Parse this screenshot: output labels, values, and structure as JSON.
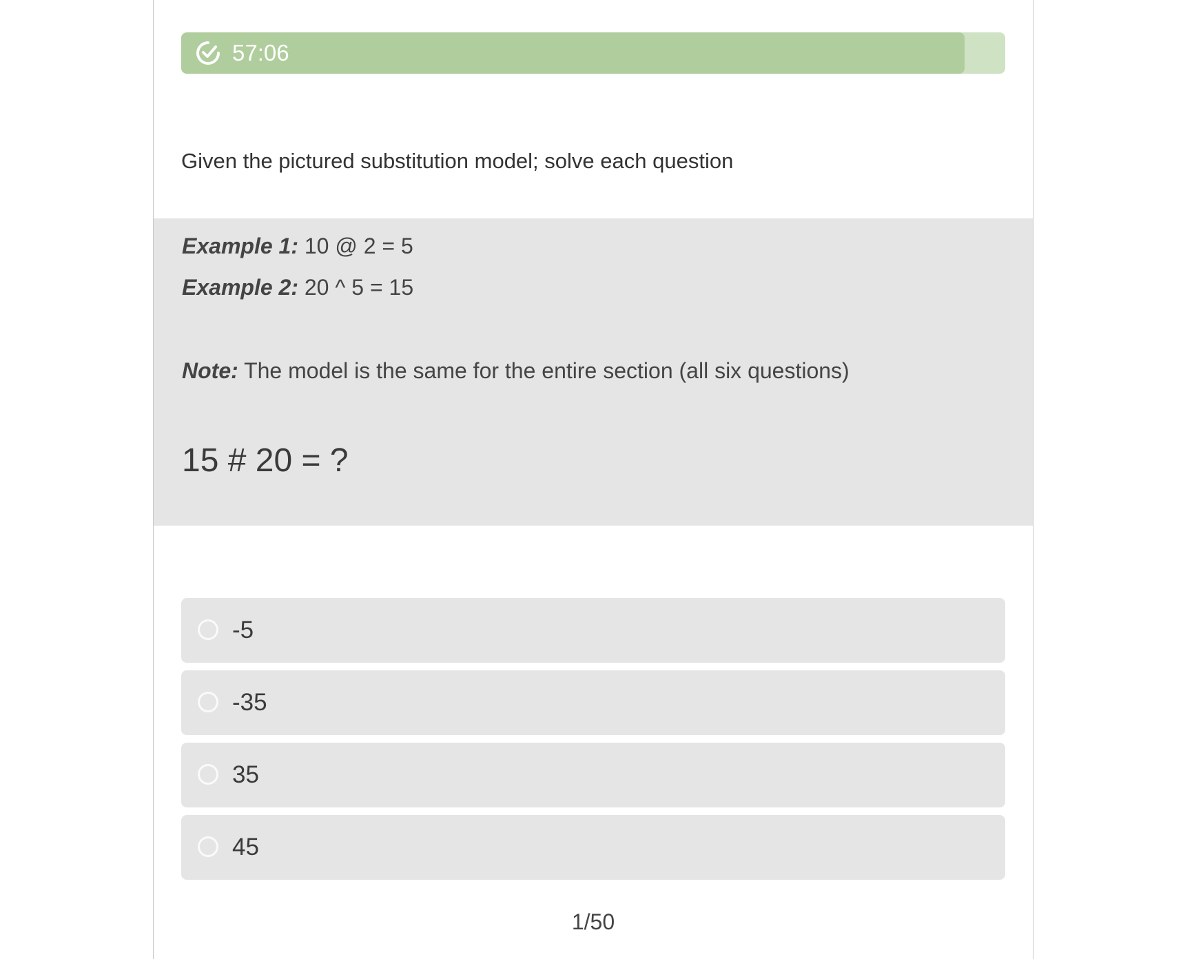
{
  "timer": {
    "time_left": "57:06",
    "progress": 0.951,
    "icon": "timer-check-icon",
    "fill_color": "#b0cd9d",
    "track_color": "#cfe2c4"
  },
  "instruction": "Given the pictured substitution model; solve each question",
  "examples": [
    {
      "label": "Example 1:",
      "text": " 10 @ 2 = 5"
    },
    {
      "label": "Example 2:",
      "text": "20 ^ 5 = 15"
    }
  ],
  "note": {
    "label": "Note:",
    "text": "The model is the same for the entire section (all six questions)"
  },
  "question": "15 # 20 = ?",
  "options": [
    {
      "label": "-5"
    },
    {
      "label": "-35"
    },
    {
      "label": "35"
    },
    {
      "label": "45"
    }
  ],
  "pager": "1/50"
}
